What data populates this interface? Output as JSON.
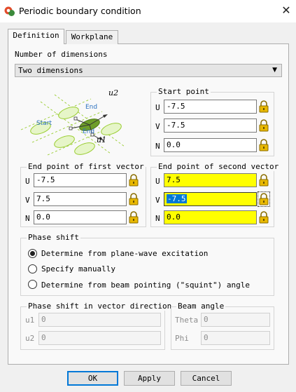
{
  "window": {
    "title": "Periodic boundary condition",
    "close_glyph": "✕",
    "app_icon": "cst-app-icon"
  },
  "tabs": [
    {
      "label": "Definition",
      "active": true
    },
    {
      "label": "Workplane",
      "active": false
    }
  ],
  "dimensions": {
    "label": "Number of dimensions",
    "selected": "Two dimensions"
  },
  "diagram": {
    "u2": "u2",
    "u1": "u1",
    "start": "Start",
    "end_top": "End",
    "end_bottom": "End"
  },
  "start_point": {
    "title": "Start point",
    "U": "-7.5",
    "V": "-7.5",
    "N": "0.0"
  },
  "first_vector": {
    "title": "End point of first vector",
    "U": "-7.5",
    "V": "7.5",
    "N": "0.0"
  },
  "second_vector": {
    "title": "End point of second vector",
    "U": "7.5",
    "V": "-7.5",
    "N": "0.0"
  },
  "axis_labels": {
    "U": "U",
    "V": "V",
    "N": "N"
  },
  "phase_shift": {
    "title": "Phase shift",
    "options": [
      {
        "label": "Determine from plane-wave excitation",
        "checked": true
      },
      {
        "label": "Specify manually",
        "checked": false
      },
      {
        "label": "Determine from beam pointing (\"squint\") angle",
        "checked": false
      }
    ]
  },
  "phase_vector": {
    "title": "Phase shift in vector direction",
    "u1_label": "u1",
    "u1": "0",
    "u2_label": "u2",
    "u2": "0"
  },
  "beam_angle": {
    "title": "Beam angle",
    "theta_label": "Theta",
    "theta": "0",
    "phi_label": "Phi",
    "phi": "0"
  },
  "buttons": {
    "ok": "OK",
    "apply": "Apply",
    "cancel": "Cancel"
  },
  "colors": {
    "highlight": "#ffff00",
    "selection": "#0078d7",
    "default_button_border": "#0078d7",
    "diagram_green": "#9acd32"
  }
}
